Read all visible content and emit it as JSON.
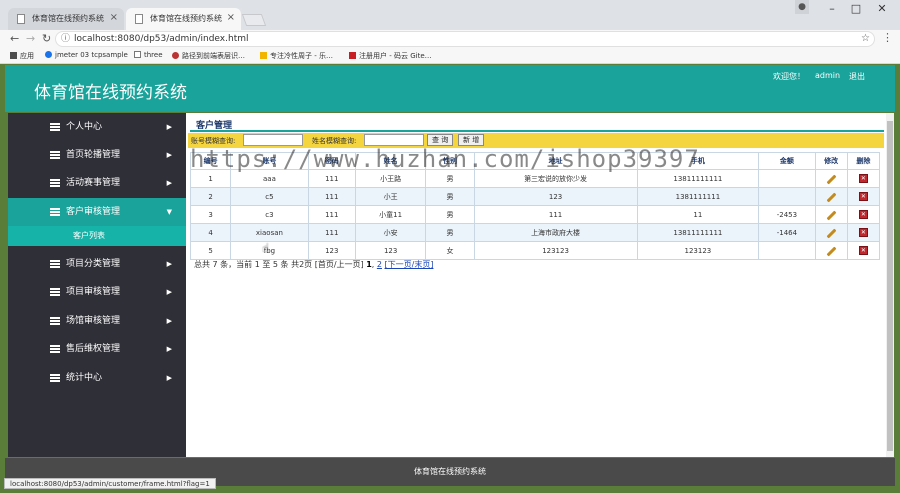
{
  "browser": {
    "tabs": [
      {
        "label": "体育馆在线预约系统"
      },
      {
        "label": "体育馆在线预约系统"
      }
    ],
    "url": "localhost:8080/dp53/admin/index.html",
    "bookmarks": [
      "应用",
      "jmeter 03 tcpsample",
      "three",
      "路径到前端表层识…",
      "专注冷性周子 - 乐…",
      "注册用户 - 码云 Gite…"
    ],
    "status_url": "localhost:8080/dp53/admin/customer/frame.html?flag=1"
  },
  "header": {
    "title": "体育馆在线预约系统",
    "welcome": "欢迎您！",
    "user": "admin",
    "logout": "退出"
  },
  "sidebar": {
    "items": [
      {
        "label": "个人中心"
      },
      {
        "label": "首页轮播管理"
      },
      {
        "label": "活动赛事管理"
      },
      {
        "label": "客户审核管理"
      },
      {
        "label": "项目分类管理"
      },
      {
        "label": "项目审核管理"
      },
      {
        "label": "场馆审核管理"
      },
      {
        "label": "售后维权管理"
      },
      {
        "label": "统计中心"
      }
    ],
    "sub_item": "客户列表"
  },
  "main": {
    "title": "客户管理",
    "search": {
      "account_label": "账号模糊查询:",
      "name_label": "姓名模糊查询:",
      "query_button": "查 询",
      "add_button": "新 增"
    },
    "columns": [
      "编号",
      "账号",
      "密码",
      "姓名",
      "性别",
      "地址",
      "手机",
      "金额",
      "修改",
      "删除"
    ],
    "rows": [
      [
        "1",
        "aaa",
        "111",
        "小王路",
        "男",
        "第三宏说的放你少发",
        "13811111111",
        ""
      ],
      [
        "2",
        "c5",
        "111",
        "小王",
        "男",
        "123",
        "1381111111",
        ""
      ],
      [
        "3",
        "c3",
        "111",
        "小童11",
        "男",
        "111",
        "11",
        "-2453"
      ],
      [
        "4",
        "xiaosan",
        "111",
        "小安",
        "男",
        "上海市政府大楼",
        "13811111111",
        "-1464"
      ],
      [
        "5",
        "fbg",
        "123",
        "123",
        "女",
        "123123",
        "123123",
        ""
      ]
    ],
    "pager": {
      "summary": "总共 7 条，当前 1 至 5 条 共2页",
      "first_prev": "[首页/上一页]",
      "page1": "1",
      "page2": "2",
      "next_last": "[下一页/末页]"
    }
  },
  "footer": {
    "text": "体育馆在线预约系统"
  },
  "watermark": "https://www.huzhan.com/ishop39397",
  "colors": {
    "accent": "#1aa39a",
    "sidebar": "#2f2f37",
    "search_bar": "#f5d53f",
    "footer": "#4a4a4a"
  }
}
